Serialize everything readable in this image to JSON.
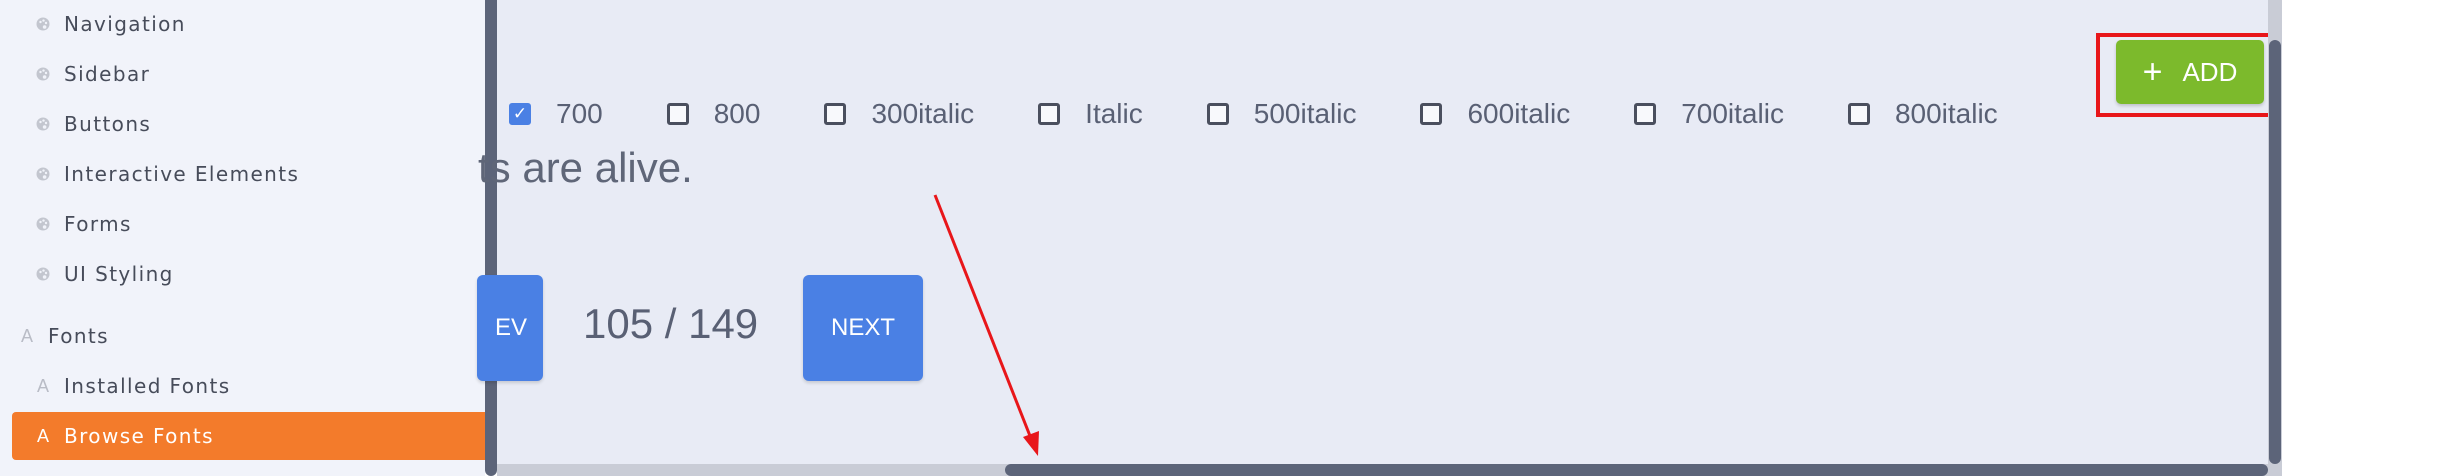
{
  "sidebar": {
    "items": [
      {
        "label": "Navigation",
        "icon": "palette-icon"
      },
      {
        "label": "Sidebar",
        "icon": "palette-icon"
      },
      {
        "label": "Buttons",
        "icon": "palette-icon"
      },
      {
        "label": "Interactive Elements",
        "icon": "palette-icon"
      },
      {
        "label": "Forms",
        "icon": "palette-icon"
      },
      {
        "label": "UI Styling",
        "icon": "palette-icon"
      }
    ],
    "section": {
      "label": "Fonts",
      "icon": "font-icon",
      "glyph": "A"
    },
    "sub_items": [
      {
        "label": "Installed Fonts",
        "icon": "font-icon",
        "glyph": "A",
        "active": false
      },
      {
        "label": "Browse Fonts",
        "icon": "font-icon",
        "glyph": "A",
        "active": true
      }
    ]
  },
  "weights": [
    {
      "label": "700",
      "checked": true
    },
    {
      "label": "800",
      "checked": false
    },
    {
      "label": "300italic",
      "checked": false
    },
    {
      "label": "Italic",
      "checked": false
    },
    {
      "label": "500italic",
      "checked": false
    },
    {
      "label": "600italic",
      "checked": false
    },
    {
      "label": "700italic",
      "checked": false
    },
    {
      "label": "800italic",
      "checked": false
    }
  ],
  "preview_text": "ts are alive.",
  "pagination": {
    "prev_label": "EV",
    "indicator": "105 / 149",
    "next_label": "NEXT"
  },
  "add_button": {
    "label": "ADD",
    "icon": "plus-icon"
  },
  "colors": {
    "accent_active": "#f37b2b",
    "primary_button": "#4a80e4",
    "add_button": "#7cba2c",
    "annotation_red": "#e8161a",
    "content_bg": "#e8ebf5",
    "sidebar_bg": "#f1f3fa"
  }
}
